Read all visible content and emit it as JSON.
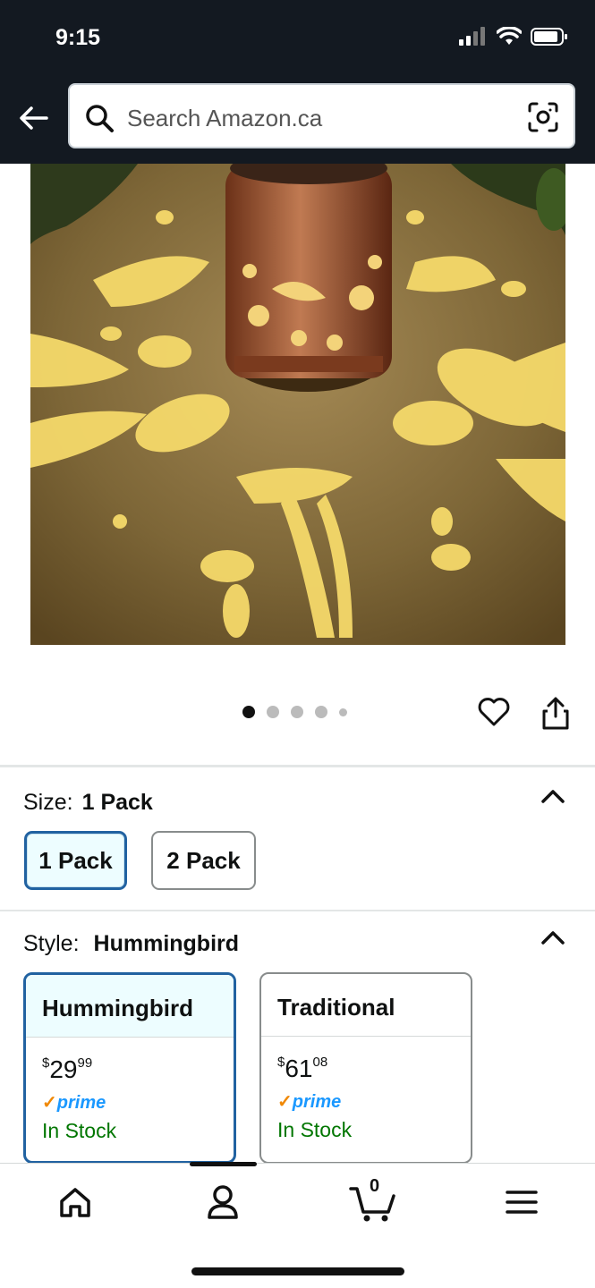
{
  "status_bar": {
    "time": "9:15"
  },
  "search": {
    "placeholder": "Search Amazon.ca"
  },
  "carousel": {
    "count": 5,
    "active_index": 0
  },
  "size": {
    "label": "Size:",
    "selected": "1 Pack",
    "options": [
      "1 Pack",
      "2 Pack"
    ]
  },
  "style": {
    "label": "Style:",
    "selected": "Hummingbird",
    "options": [
      {
        "name": "Hummingbird",
        "price_currency": "$",
        "price_whole": "29",
        "price_fraction": "99",
        "prime": "prime",
        "stock": "In Stock"
      },
      {
        "name": "Traditional",
        "price_currency": "$",
        "price_whole": "61",
        "price_fraction": "08",
        "prime": "prime",
        "stock": "In Stock"
      }
    ]
  },
  "nav": {
    "cart_count": "0"
  },
  "colors": {
    "header_bg": "#131921",
    "selected_border": "#2162a1",
    "stock_green": "#007600",
    "prime_blue": "#1a98ff"
  }
}
